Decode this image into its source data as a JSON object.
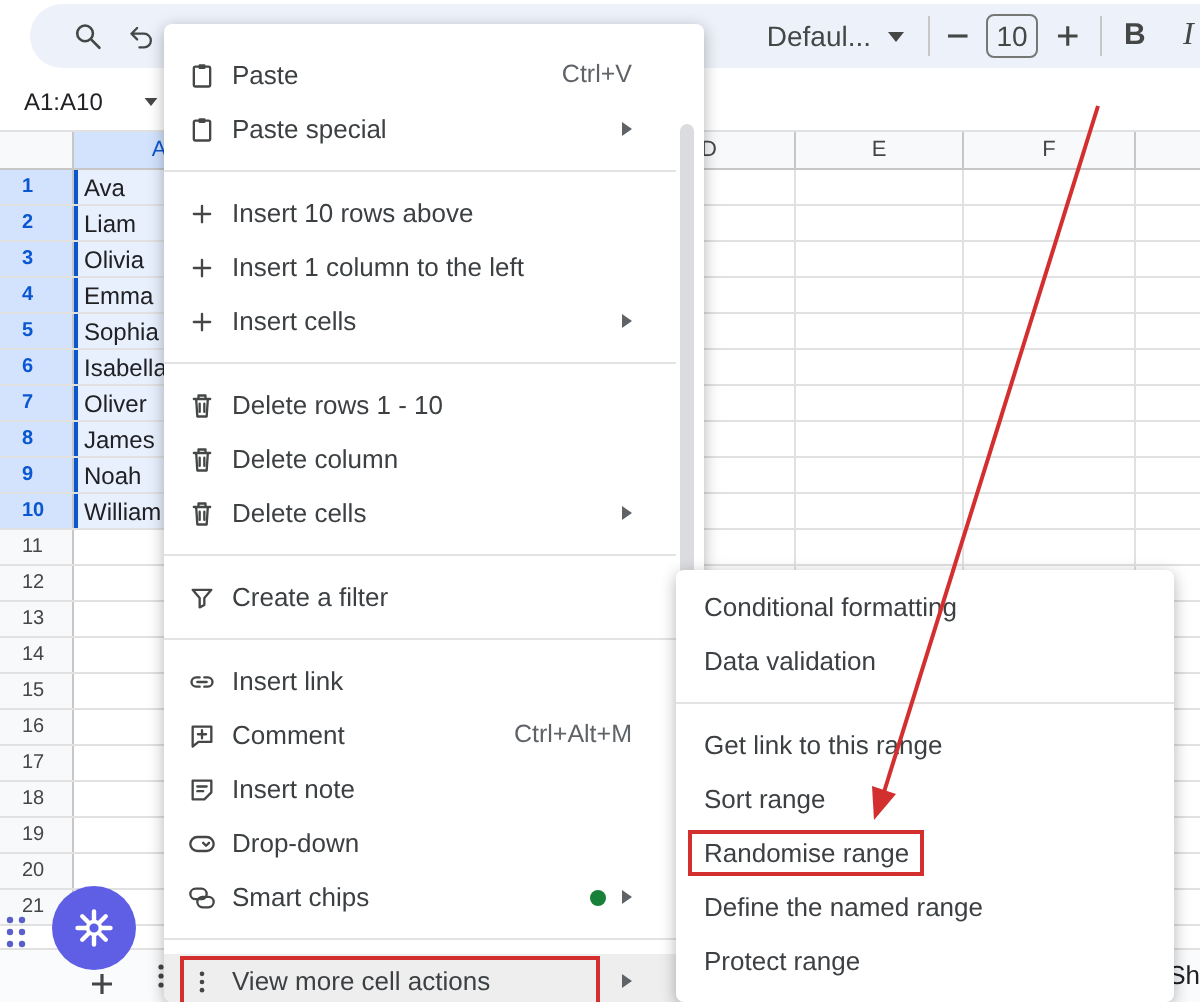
{
  "toolbar": {
    "font": "Defaul...",
    "font_size": "10",
    "bold": "B",
    "italic": "I"
  },
  "name_box": "A1:A10",
  "columns": [
    {
      "label": "A",
      "selected": true
    },
    {
      "label": "D",
      "selected": false
    },
    {
      "label": "E",
      "selected": false
    },
    {
      "label": "F",
      "selected": false
    }
  ],
  "rows": [
    {
      "number": "1",
      "value": "Ava",
      "selected": true
    },
    {
      "number": "2",
      "value": "Liam",
      "selected": true
    },
    {
      "number": "3",
      "value": "Olivia",
      "selected": true
    },
    {
      "number": "4",
      "value": "Emma",
      "selected": true
    },
    {
      "number": "5",
      "value": "Sophia",
      "selected": true
    },
    {
      "number": "6",
      "value": "Isabella",
      "selected": true
    },
    {
      "number": "7",
      "value": "Oliver",
      "selected": true
    },
    {
      "number": "8",
      "value": "James",
      "selected": true
    },
    {
      "number": "9",
      "value": "Noah",
      "selected": true
    },
    {
      "number": "10",
      "value": "William",
      "selected": true
    },
    {
      "number": "11",
      "selected": false
    },
    {
      "number": "12",
      "selected": false
    },
    {
      "number": "13",
      "selected": false
    },
    {
      "number": "14",
      "selected": false
    },
    {
      "number": "15",
      "selected": false
    },
    {
      "number": "16",
      "selected": false
    },
    {
      "number": "17",
      "selected": false
    },
    {
      "number": "18",
      "selected": false
    },
    {
      "number": "19",
      "selected": false
    },
    {
      "number": "20",
      "selected": false
    },
    {
      "number": "21",
      "selected": false
    }
  ],
  "context_menu": {
    "sections": [
      [
        {
          "kind": "paste",
          "label": "Paste",
          "shortcut": "Ctrl+V",
          "submenu": false,
          "highlighted": false,
          "outlined": false
        },
        {
          "kind": "paste",
          "label": "Paste special",
          "submenu": true,
          "highlighted": false,
          "outlined": false
        }
      ],
      [
        {
          "kind": "insert",
          "label": "Insert 10 rows above",
          "submenu": false,
          "highlighted": false,
          "outlined": false
        },
        {
          "kind": "insert",
          "label": "Insert 1 column to the left",
          "submenu": false,
          "highlighted": false,
          "outlined": false
        },
        {
          "kind": "insert",
          "label": "Insert cells",
          "submenu": true,
          "highlighted": false,
          "outlined": false
        }
      ],
      [
        {
          "kind": "delete",
          "label": "Delete rows 1 - 10",
          "submenu": false,
          "highlighted": false,
          "outlined": false
        },
        {
          "kind": "delete",
          "label": "Delete column",
          "submenu": false,
          "highlighted": false,
          "outlined": false
        },
        {
          "kind": "delete",
          "label": "Delete cells",
          "submenu": true,
          "highlighted": false,
          "outlined": false
        }
      ],
      [
        {
          "kind": "filter",
          "label": "Create a filter",
          "submenu": false,
          "highlighted": false,
          "outlined": false
        }
      ],
      [
        {
          "kind": "link",
          "label": "Insert link",
          "submenu": false,
          "highlighted": false,
          "outlined": false
        },
        {
          "kind": "comment",
          "label": "Comment",
          "shortcut": "Ctrl+Alt+M",
          "submenu": false,
          "highlighted": false,
          "outlined": false
        },
        {
          "kind": "note",
          "label": "Insert note",
          "submenu": false,
          "highlighted": false,
          "outlined": false
        },
        {
          "kind": "dropdown",
          "label": "Drop-down",
          "submenu": false,
          "highlighted": false,
          "outlined": false
        },
        {
          "kind": "chips",
          "label": "Smart chips",
          "submenu": true,
          "highlighted": false,
          "outlined": false,
          "color": "#188038"
        }
      ],
      [
        {
          "kind": "more",
          "label": "View more cell actions",
          "submenu": true,
          "highlighted": true,
          "outlined": true
        }
      ]
    ]
  },
  "submenu": {
    "sections": [
      [
        {
          "label": "Conditional formatting",
          "outlined": false
        },
        {
          "label": "Data validation",
          "outlined": false
        }
      ],
      [
        {
          "label": "Get link to this range",
          "outlined": false
        },
        {
          "label": "Sort range",
          "outlined": false
        },
        {
          "label": "Randomise range",
          "outlined": true
        },
        {
          "label": "Define the named range",
          "outlined": false
        },
        {
          "label": "Protect range",
          "outlined": false
        }
      ]
    ]
  },
  "sheet_bar": {
    "tab": "Sh"
  }
}
